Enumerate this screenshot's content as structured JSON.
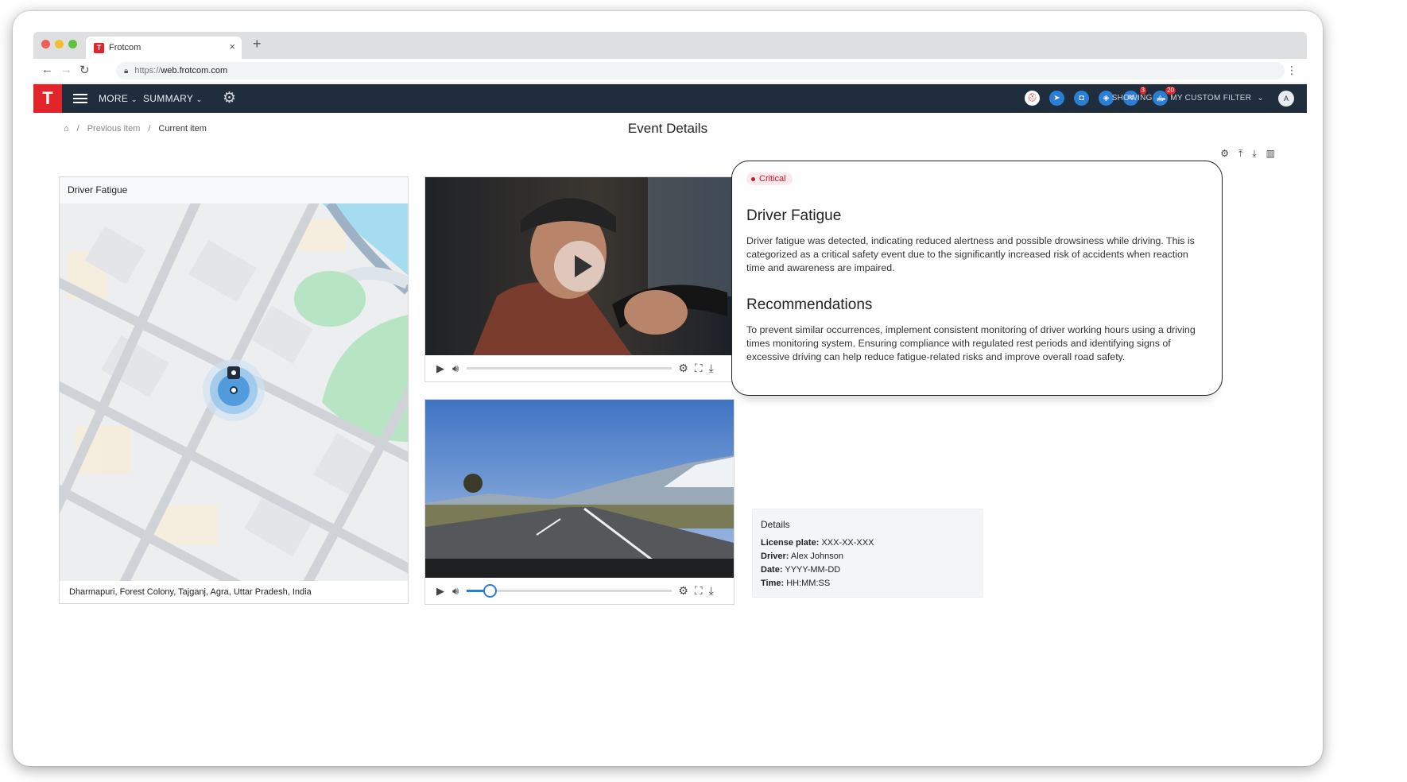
{
  "browser": {
    "tab_title": "Frotcom",
    "tab_favicon": "T",
    "url_proto": "https://",
    "url_host": "web.frotcom.com"
  },
  "nav": {
    "logo": "T",
    "more_label": "MORE",
    "summary_label": "SUMMARY",
    "badge_1": "3",
    "badge_2": "20",
    "showing_label": "SHOWING",
    "filter_label": "MY CUSTOM FILTER",
    "avatar": "A"
  },
  "breadcrumb": {
    "previous": "Previous item",
    "current": "Current item"
  },
  "page": {
    "title": "Event Details"
  },
  "map": {
    "title": "Driver Fatigue",
    "address": "Dharmapuri, Forest Colony, Tajganj, Agra, Uttar Pradesh, India"
  },
  "video2": {
    "progress_fraction": 0.11
  },
  "event": {
    "severity": "Critical",
    "title": "Driver Fatigue",
    "description": "Driver fatigue was detected, indicating reduced alertness and possible drowsiness while driving. This is categorized as a critical safety event due to the significantly increased risk of accidents when reaction time and awareness are impaired.",
    "recommendations_title": "Recommendations",
    "recommendations": "To prevent similar occurrences, implement consistent monitoring of driver working hours using a driving times monitoring system. Ensuring compliance with regulated rest periods and identifying signs of excessive driving can help reduce fatigue-related risks and improve overall road safety."
  },
  "details": {
    "title": "Details",
    "license_label": "License plate:",
    "license_value": "XXX-XX-XXX",
    "driver_label": "Driver:",
    "driver_value": "Alex Johnson",
    "date_label": "Date:",
    "date_value": "YYYY-MM-DD",
    "time_label": "Time:",
    "time_value": "HH:MM:SS"
  },
  "colors": {
    "brand_red": "#e1242a",
    "nav_bg": "#1f2d3d",
    "accent_blue": "#2a7fd4",
    "critical": "#c4182a"
  }
}
